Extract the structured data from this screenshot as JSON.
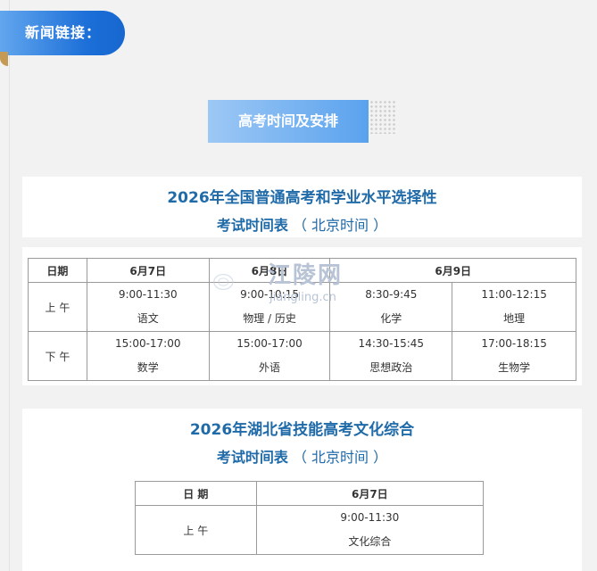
{
  "news_link": {
    "label": "新闻链接："
  },
  "section_button": {
    "label": "高考时间及安排"
  },
  "exam1": {
    "title_line1": "2026年全国普通高考和学业水平选择性",
    "title_line2": "考试时间表",
    "title_note": "（ 北京时间 ）",
    "header": {
      "date_label": "日期",
      "d1": "6月7日",
      "d2": "6月8日",
      "d3": "6月9日"
    },
    "am": {
      "label": "上 午",
      "slots": [
        {
          "time": "9:00-11:30",
          "subject": "语文"
        },
        {
          "time": "9:00-10:15",
          "subject": "物理 / 历史"
        },
        {
          "time": "8:30-9:45",
          "subject": "化学"
        },
        {
          "time": "11:00-12:15",
          "subject": "地理"
        }
      ]
    },
    "pm": {
      "label": "下 午",
      "slots": [
        {
          "time": "15:00-17:00",
          "subject": "数学"
        },
        {
          "time": "15:00-17:00",
          "subject": "外语"
        },
        {
          "time": "14:30-15:45",
          "subject": "思想政治"
        },
        {
          "time": "17:00-18:15",
          "subject": "生物学"
        }
      ]
    }
  },
  "exam2": {
    "title_line1": "2026年湖北省技能高考文化综合",
    "title_line2": "考试时间表",
    "title_note": "（ 北京时间 ）",
    "header": {
      "date_label": "日 期",
      "d1": "6月7日"
    },
    "am": {
      "label": "上 午",
      "time": "9:00-11:30",
      "subject": "文化综合"
    }
  },
  "watermark": {
    "text": "江陵网",
    "url": "jiangling.cn"
  }
}
